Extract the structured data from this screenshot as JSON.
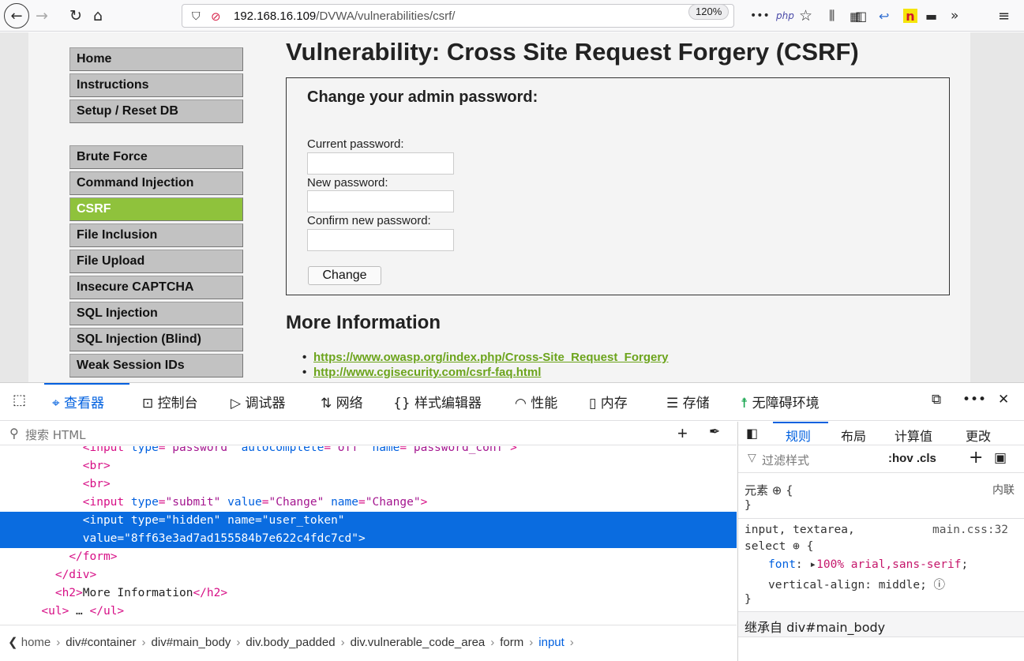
{
  "browser": {
    "url_host": "192.168.16.109",
    "url_path": "/DVWA/vulnerabilities/csrf/",
    "zoom": "120%"
  },
  "page": {
    "title": "Vulnerability: Cross Site Request Forgery (CSRF)",
    "menu_top": [
      "Home",
      "Instructions",
      "Setup / Reset DB"
    ],
    "menu_vulns": [
      "Brute Force",
      "Command Injection",
      "CSRF",
      "File Inclusion",
      "File Upload",
      "Insecure CAPTCHA",
      "SQL Injection",
      "SQL Injection (Blind)",
      "Weak Session IDs"
    ],
    "active_item": "CSRF",
    "form": {
      "heading": "Change your admin password:",
      "current_label": "Current password:",
      "new_label": "New password:",
      "confirm_label": "Confirm new password:",
      "button": "Change"
    },
    "more_info_heading": "More Information",
    "links": [
      "https://www.owasp.org/index.php/Cross-Site_Request_Forgery",
      "http://www.cgisecurity.com/csrf-faq.html"
    ]
  },
  "devtools": {
    "tabs": [
      "查看器",
      "控制台",
      "调试器",
      "网络",
      "样式编辑器",
      "性能",
      "内存",
      "存储",
      "无障碍环境"
    ],
    "selected_tab": "查看器",
    "search_placeholder": "搜索 HTML",
    "code_lines": [
      {
        "indent": "            ",
        "parts": [
          [
            "t",
            "<input "
          ],
          [
            "a",
            "type"
          ],
          [
            "t",
            "="
          ],
          [
            "v",
            "\"password\""
          ],
          [
            "t",
            " "
          ],
          [
            "a",
            "autocomplete"
          ],
          [
            "t",
            "="
          ],
          [
            "v",
            "\"off\""
          ],
          [
            "t",
            " "
          ],
          [
            "a",
            "name"
          ],
          [
            "t",
            "="
          ],
          [
            "v",
            "\"password_conf\""
          ],
          [
            "t",
            ">"
          ]
        ]
      },
      {
        "indent": "            ",
        "parts": [
          [
            "t",
            "<br>"
          ]
        ]
      },
      {
        "indent": "            ",
        "parts": [
          [
            "t",
            "<br>"
          ]
        ]
      },
      {
        "indent": "            ",
        "parts": [
          [
            "t",
            "<input "
          ],
          [
            "a",
            "type"
          ],
          [
            "t",
            "="
          ],
          [
            "v",
            "\"submit\""
          ],
          [
            "t",
            " "
          ],
          [
            "a",
            "value"
          ],
          [
            "t",
            "="
          ],
          [
            "v",
            "\"Change\""
          ],
          [
            "t",
            " "
          ],
          [
            "a",
            "name"
          ],
          [
            "t",
            "="
          ],
          [
            "v",
            "\"Change\""
          ],
          [
            "t",
            ">"
          ]
        ]
      },
      {
        "indent": "            ",
        "selected": true,
        "parts": [
          [
            "t",
            "<input "
          ],
          [
            "a",
            "type"
          ],
          [
            "t",
            "="
          ],
          [
            "v",
            "\"hidden\""
          ],
          [
            "t",
            " "
          ],
          [
            "a",
            "name"
          ],
          [
            "t",
            "="
          ],
          [
            "v",
            "\"user_token\""
          ]
        ]
      },
      {
        "indent": "            ",
        "selected": true,
        "parts": [
          [
            "a",
            "value"
          ],
          [
            "t",
            "="
          ],
          [
            "v",
            "\"8ff63e3ad7ad155584b7e622c4fdc7cd\""
          ],
          [
            "t",
            ">"
          ]
        ]
      },
      {
        "indent": "          ",
        "parts": [
          [
            "t",
            "</form>"
          ]
        ]
      },
      {
        "indent": "        ",
        "parts": [
          [
            "t",
            "</div>"
          ]
        ]
      },
      {
        "indent": "        ",
        "parts": [
          [
            "t",
            "<h2>"
          ],
          [
            "x",
            "More Information"
          ],
          [
            "t",
            "</h2>"
          ]
        ]
      },
      {
        "indent": "      ",
        "parts": [
          [
            "t",
            "<ul>"
          ],
          [
            "x",
            " … "
          ],
          [
            "t",
            "</ul>"
          ]
        ]
      }
    ],
    "breadcrumbs": [
      "home",
      "div#container",
      "div#main_body",
      "div.body_padded",
      "div.vulnerable_code_area",
      "form",
      "input"
    ],
    "right_tabs": [
      "规则",
      "布局",
      "计算值",
      "更改"
    ],
    "filter_placeholder": "过滤样式",
    "hov_cls": ":hov .cls",
    "element_rule": "元素",
    "inline_label": "内联",
    "selector": "input, textarea,",
    "selector2": "select",
    "source": "main.css:32",
    "prop1_name": "font",
    "prop1_value": "100% arial,sans-serif",
    "prop2_name": "vertical-align",
    "prop2_value": "middle",
    "inherited": "继承自 div#main_body"
  }
}
